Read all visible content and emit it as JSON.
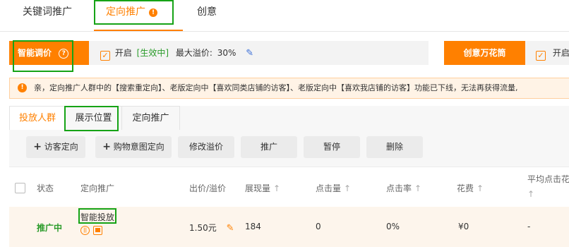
{
  "top_tabs": [
    {
      "label": "关键词推广"
    },
    {
      "label": "定向推广"
    },
    {
      "label": "创意"
    }
  ],
  "smart_bid": {
    "label": "智能调价",
    "enabled_label": "开启",
    "status": "[生效中]",
    "max_premium_label": "最大溢价:",
    "max_premium_value": "30%"
  },
  "creative_box": {
    "label": "创意万花筒",
    "enabled_label": "开启"
  },
  "notice": {
    "text": "亲，定向推广人群中的【搜索重定向】、老版定向中【喜欢同类店铺的访客】、老版定向中【喜欢我店铺的访客】功能已下线，无法再获得流量,"
  },
  "sub_tabs": [
    {
      "label": "投放人群"
    },
    {
      "label": "展示位置"
    },
    {
      "label": "定向推广"
    }
  ],
  "toolbar": {
    "visitor_targeting": "访客定向",
    "purchase_intent_targeting": "购物意图定向",
    "modify_premium": "修改溢价",
    "promote": "推广",
    "pause": "暂停",
    "delete": "删除"
  },
  "table": {
    "headers": {
      "status": "状态",
      "targeting": "定向推广",
      "bid": "出价/溢价",
      "impressions": "展现量",
      "clicks": "点击量",
      "ctr": "点击率",
      "cost": "花费",
      "avg_cpc": "平均点击花"
    },
    "rows": [
      {
        "status": "推广中",
        "name": "智能投放",
        "bid": "1.50元",
        "impressions": "184",
        "clicks": "0",
        "ctr": "0%",
        "cost": "¥0",
        "avg_cpc": "-"
      }
    ]
  },
  "colors": {
    "accent": "#ff8000",
    "highlight_border": "#16a316",
    "status_green": "#2a9b2a",
    "notice_bg": "#fff3e6"
  }
}
